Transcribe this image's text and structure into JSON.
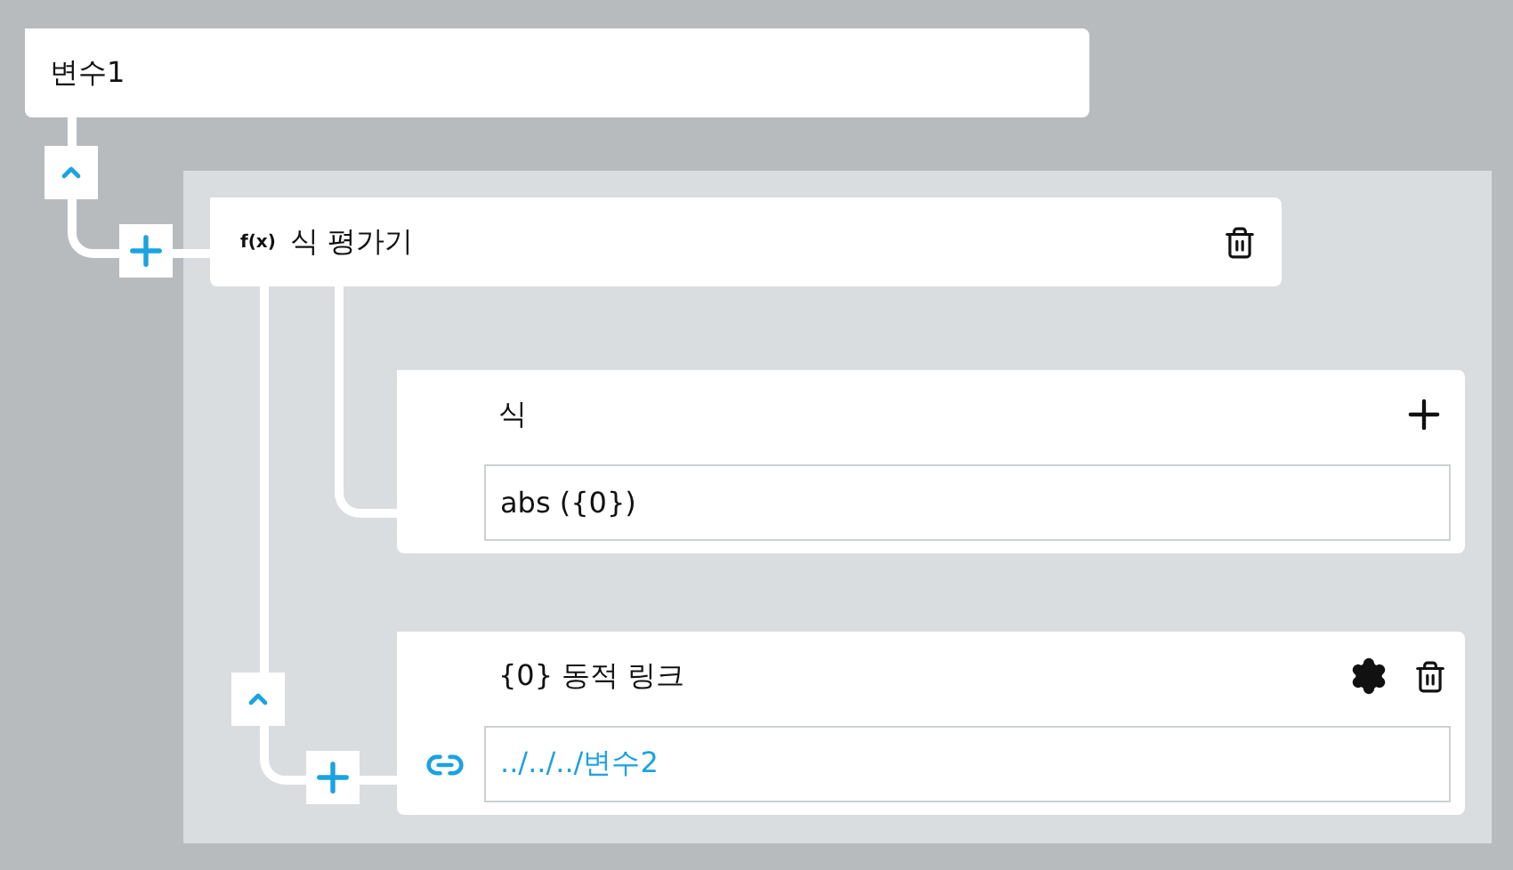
{
  "variable": {
    "title": "변수1",
    "expanded": true
  },
  "evaluator": {
    "icon_text": "f(x)",
    "title": "식 평가기",
    "expression": {
      "label": "식",
      "value": "abs ({0})"
    },
    "dynamic_link": {
      "title": "{0} 동적 링크",
      "value": "../../../변수2",
      "expanded": true
    }
  }
}
